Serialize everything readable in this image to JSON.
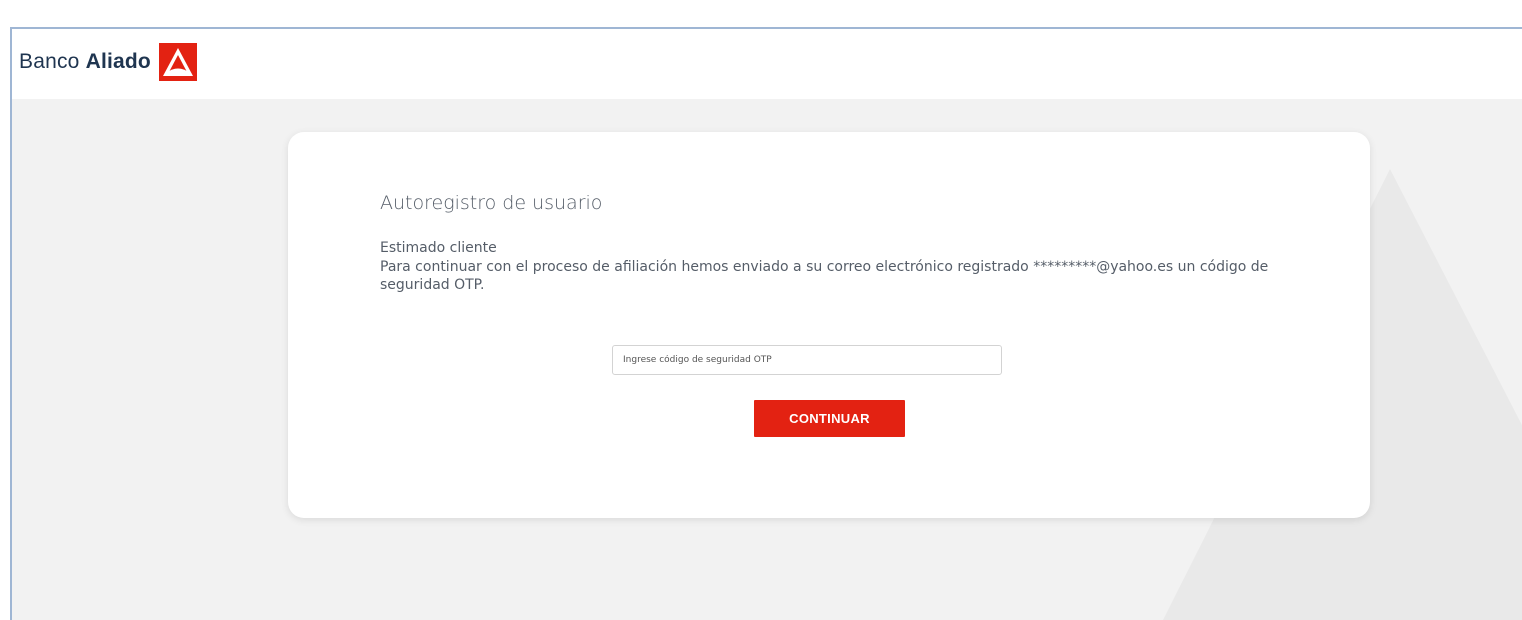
{
  "brand": {
    "name_regular": "Banco ",
    "name_bold": "Aliado",
    "accent_color": "#e32212",
    "logo_icon": "triangle-logo-icon"
  },
  "card": {
    "title": "Autoregistro de usuario",
    "greeting": "Estimado cliente",
    "message": "Para continuar con el proceso de afiliación hemos enviado a su correo electrónico registrado *********@yahoo.es un código de seguridad OTP."
  },
  "otp": {
    "placeholder": "Ingrese código de seguridad OTP",
    "value": ""
  },
  "buttons": {
    "continue_label": "CONTINUAR"
  }
}
